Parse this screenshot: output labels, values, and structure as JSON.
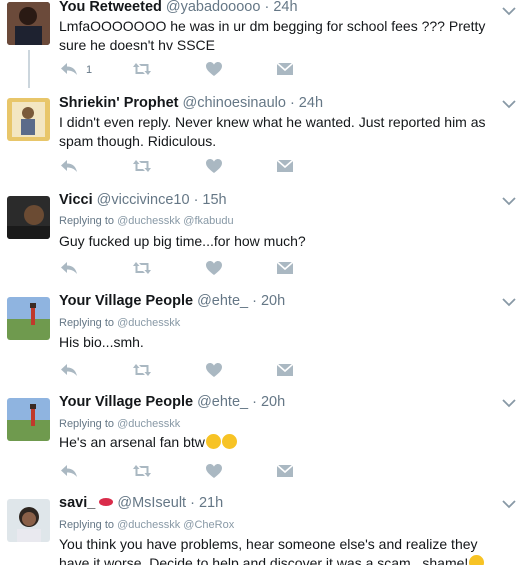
{
  "tweets": [
    {
      "retweet_label": "You Retweeted",
      "handle": "@yabadooooo",
      "time": "· 24h",
      "text": "LmfaOOOOOOO he was in ur dm begging for school fees ??? Pretty sure he doesn't hv SSCE",
      "reply_count": "1"
    },
    {
      "name": "Shriekin' Prophet",
      "handle": "@chinoesinaulo",
      "time": "· 24h",
      "text": "I didn't even reply. Never knew what he wanted. Just reported him as spam though. Ridiculous."
    },
    {
      "name": "Vicci",
      "handle": "@viccivince10",
      "time": "· 15h",
      "replying_label": "Replying to",
      "replying_to": "@duchesskk @fkabudu",
      "text": "Guy fucked up big time...for how much?"
    },
    {
      "name": "Your Village People",
      "handle": "@ehte_",
      "time": "· 20h",
      "replying_label": "Replying to",
      "replying_to": "@duchesskk",
      "text": "His bio...smh."
    },
    {
      "name": "Your Village People",
      "handle": "@ehte_",
      "time": "· 20h",
      "replying_label": "Replying to",
      "replying_to": "@duchesskk",
      "text": "He's an arsenal fan btw"
    },
    {
      "name": "savi_",
      "handle": "@MsIseult",
      "time": "· 21h",
      "replying_label": "Replying to",
      "replying_to": "@duchesskk @CheRox",
      "text": "You think you have problems, hear someone else's and realize they have it worse. Decide to help and discover it was a scam...shame!"
    }
  ],
  "icons": {
    "reply": "reply-icon",
    "retweet": "retweet-icon",
    "like": "heart-icon",
    "dm": "envelope-icon",
    "more": "chevron-down-icon"
  },
  "colors": {
    "action_gray": "#aab8c2",
    "text_gray": "#657786",
    "divider": "#e6ecf0"
  }
}
